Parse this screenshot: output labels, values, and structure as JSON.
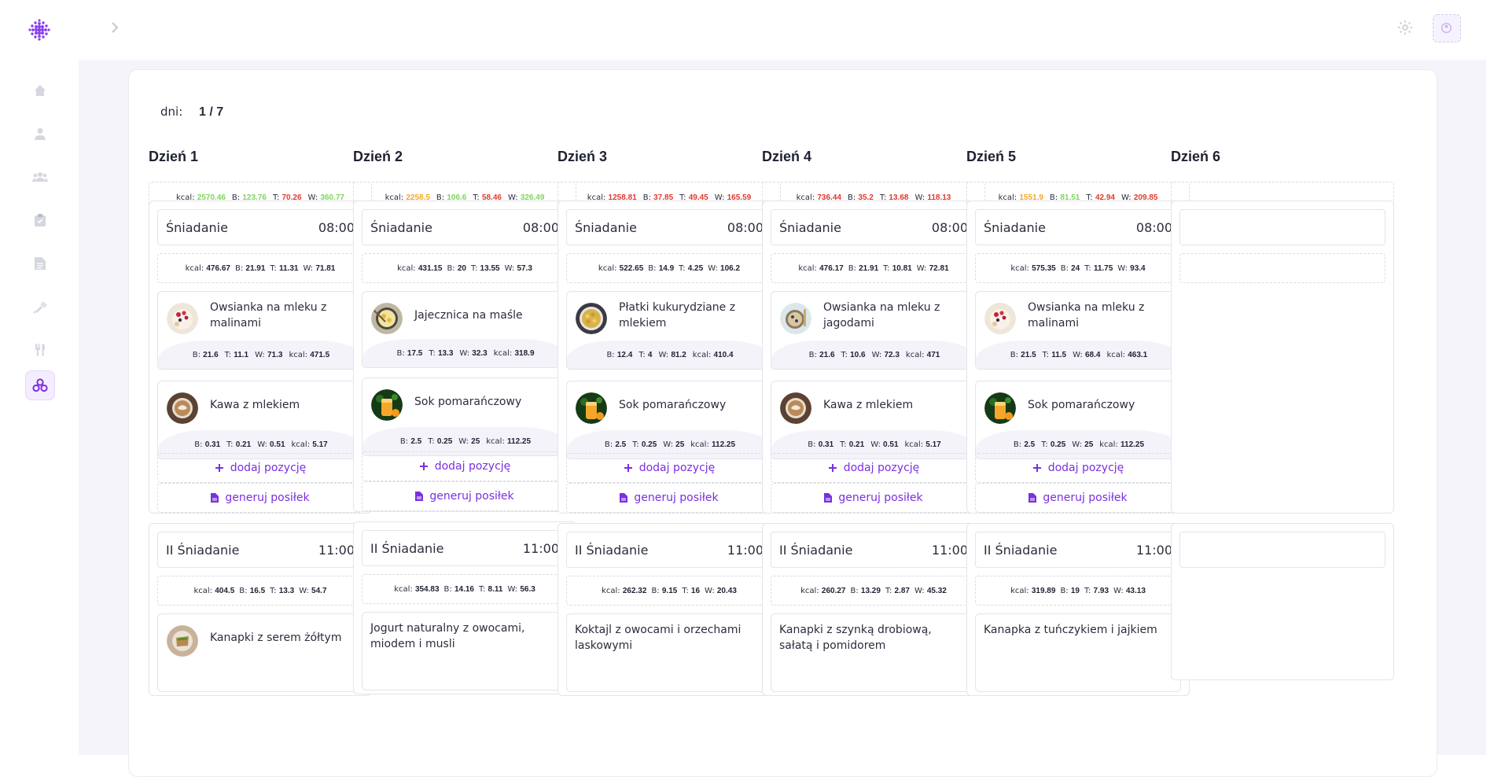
{
  "nav": {
    "icons": [
      "home-icon",
      "user-icon",
      "users-icon",
      "clipboard-icon",
      "document-icon",
      "syringe-icon",
      "utensils-icon",
      "molecule-icon"
    ]
  },
  "planner": {
    "days_label": "dni:",
    "days_value": "1 / 7",
    "add_label": "dodaj pozycję",
    "generate_label": "generuj posiłek",
    "days": [
      {
        "title": "Dzień 1",
        "summary": {
          "kcal": "2570.46",
          "B": "123.76",
          "T": "70.26",
          "W": "360.77",
          "colors": [
            "green",
            "green",
            "red",
            "green"
          ]
        },
        "breakfast": {
          "name": "Śniadanie",
          "time": "08:00",
          "summary": {
            "kcal": "476.67",
            "B": "21.91",
            "T": "11.31",
            "W": "71.81",
            "kcal_color": "orange"
          },
          "dishes": [
            {
              "name": "Owsianka na mleku z malinami",
              "thumb": "oatmeal",
              "B": "21.6",
              "T": "11.1",
              "W": "71.3",
              "kcal": "471.5"
            },
            {
              "name": "Kawa z mlekiem",
              "thumb": "coffee",
              "B": "0.31",
              "T": "0.21",
              "W": "0.51",
              "kcal": "5.17"
            }
          ]
        },
        "second": {
          "name": "II Śniadanie",
          "time": "11:00",
          "summary": {
            "kcal": "404.5",
            "B": "16.5",
            "T": "13.3",
            "W": "54.7",
            "kcal_color": "red"
          },
          "first_dish": "Kanapki z serem żółtym"
        }
      },
      {
        "title": "Dzień 2",
        "summary": {
          "kcal": "2258.5",
          "B": "106.6",
          "T": "58.46",
          "W": "326.49",
          "colors": [
            "orange",
            "green",
            "red",
            "green"
          ]
        },
        "breakfast": {
          "name": "Śniadanie",
          "time": "08:00",
          "summary": {
            "kcal": "431.15",
            "B": "20",
            "T": "13.55",
            "W": "57.3",
            "kcal_color": "orange"
          },
          "dishes": [
            {
              "name": "Jajecznica na maśle",
              "thumb": "eggs",
              "B": "17.5",
              "T": "13.3",
              "W": "32.3",
              "kcal": "318.9"
            },
            {
              "name": "Sok pomarańczowy",
              "thumb": "juice",
              "B": "2.5",
              "T": "0.25",
              "W": "25",
              "kcal": "112.25"
            }
          ]
        },
        "second": {
          "name": "II Śniadanie",
          "time": "11:00",
          "summary": {
            "kcal": "354.83",
            "B": "14.16",
            "T": "8.11",
            "W": "56.3",
            "kcal_color": "orange"
          },
          "first_dish": "Jogurt naturalny z owocami, miodem i musli"
        }
      },
      {
        "title": "Dzień 3",
        "summary": {
          "kcal": "1258.81",
          "B": "37.85",
          "T": "49.45",
          "W": "165.59",
          "colors": [
            "red",
            "red",
            "red",
            "red"
          ]
        },
        "breakfast": {
          "name": "Śniadanie",
          "time": "08:00",
          "summary": {
            "kcal": "522.65",
            "B": "14.9",
            "T": "4.25",
            "W": "106.2",
            "kcal_color": "orange"
          },
          "dishes": [
            {
              "name": "Płatki kukurydziane z mlekiem",
              "thumb": "cereal",
              "B": "12.4",
              "T": "4",
              "W": "81.2",
              "kcal": "410.4"
            },
            {
              "name": "Sok pomarańczowy",
              "thumb": "juice",
              "B": "2.5",
              "T": "0.25",
              "W": "25",
              "kcal": "112.25"
            }
          ]
        },
        "second": {
          "name": "II Śniadanie",
          "time": "11:00",
          "summary": {
            "kcal": "262.32",
            "B": "9.15",
            "T": "16",
            "W": "20.43",
            "kcal_color": "green"
          },
          "first_dish": "Koktajl z owocami i orzechami laskowymi"
        }
      },
      {
        "title": "Dzień 4",
        "summary": {
          "kcal": "736.44",
          "B": "35.2",
          "T": "13.68",
          "W": "118.13",
          "colors": [
            "red",
            "red",
            "red",
            "red"
          ]
        },
        "breakfast": {
          "name": "Śniadanie",
          "time": "08:00",
          "summary": {
            "kcal": "476.17",
            "B": "21.91",
            "T": "10.81",
            "W": "72.81",
            "kcal_color": "orange"
          },
          "dishes": [
            {
              "name": "Owsianka na mleku z jagodami",
              "thumb": "oatmeal2",
              "B": "21.6",
              "T": "10.6",
              "W": "72.3",
              "kcal": "471"
            },
            {
              "name": "Kawa z mlekiem",
              "thumb": "coffee",
              "B": "0.31",
              "T": "0.21",
              "W": "0.51",
              "kcal": "5.17"
            }
          ]
        },
        "second": {
          "name": "II Śniadanie",
          "time": "11:00",
          "summary": {
            "kcal": "260.27",
            "B": "13.29",
            "T": "2.87",
            "W": "45.32",
            "kcal_color": "green"
          },
          "first_dish": "Kanapki z szynką drobiową, sałatą i pomidorem"
        }
      },
      {
        "title": "Dzień 5",
        "summary": {
          "kcal": "1551.9",
          "B": "81.51",
          "T": "42.94",
          "W": "209.85",
          "colors": [
            "orange",
            "green",
            "red",
            "red"
          ]
        },
        "breakfast": {
          "name": "Śniadanie",
          "time": "08:00",
          "summary": {
            "kcal": "575.35",
            "B": "24",
            "T": "11.75",
            "W": "93.4",
            "kcal_color": "orange"
          },
          "dishes": [
            {
              "name": "Owsianka na mleku z malinami",
              "thumb": "oatmeal",
              "B": "21.5",
              "T": "11.5",
              "W": "68.4",
              "kcal": "463.1"
            },
            {
              "name": "Sok pomarańczowy",
              "thumb": "juice",
              "B": "2.5",
              "T": "0.25",
              "W": "25",
              "kcal": "112.25"
            }
          ]
        },
        "second": {
          "name": "II Śniadanie",
          "time": "11:00",
          "summary": {
            "kcal": "319.89",
            "B": "19",
            "T": "7.93",
            "W": "43.13",
            "kcal_color": "orange"
          },
          "first_dish": "Kanapka z tuńczykiem i jajkiem"
        }
      },
      {
        "title": "Dzień 6"
      }
    ]
  },
  "colors": {
    "accent": "#7b2fe0",
    "green": "#7fd65c",
    "orange": "#f5a623",
    "red": "#e03a2e",
    "background": "#f5f4fb"
  }
}
